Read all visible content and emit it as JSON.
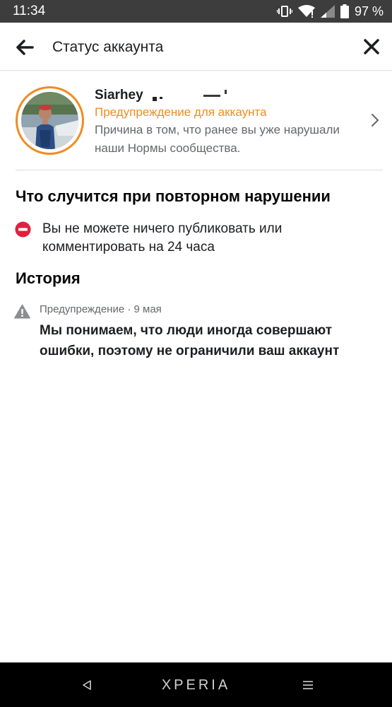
{
  "status_bar": {
    "time": "11:34",
    "battery": "97 %"
  },
  "header": {
    "title": "Статус аккаунта",
    "back_icon": "arrow-left-icon",
    "close_icon": "close-icon"
  },
  "account": {
    "name": "Siarhey",
    "status": "Предупреждение для аккаунта",
    "reason": "Причина в том, что ранее вы уже нарушали наши Нормы сообщества.",
    "accent_color": "#f28b21"
  },
  "repeat_violation": {
    "heading": "Что случится при повторном нарушении",
    "restriction": "Вы не можете ничего публиковать или комментировать на 24 часа",
    "icon_color": "#e41e3f"
  },
  "history": {
    "heading": "История",
    "items": [
      {
        "meta": "Предупреждение · 9 мая",
        "text": "Мы понимаем, что люди иногда совершают ошибки, поэтому не ограничили ваш аккаунт"
      }
    ]
  },
  "nav_bar": {
    "brand": "XPERIA"
  }
}
